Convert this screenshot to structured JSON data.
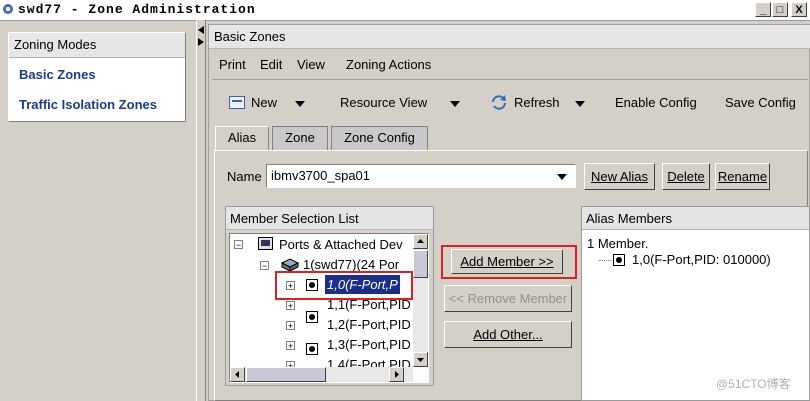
{
  "window": {
    "title": "swd77 - Zone Administration",
    "minimize": "_",
    "maximize": "□",
    "close": "X"
  },
  "left_panel": {
    "header": "Zoning Modes",
    "items": [
      {
        "label": "Basic Zones"
      },
      {
        "label": "Traffic Isolation Zones"
      }
    ]
  },
  "main": {
    "header": "Basic Zones",
    "menu": [
      "Print",
      "Edit",
      "View",
      "Zoning Actions"
    ],
    "toolbar": {
      "new": "New",
      "resource_view": "Resource View",
      "refresh": "Refresh",
      "enable_config": "Enable Config",
      "save_config": "Save Config"
    },
    "tabs": [
      "Alias",
      "Zone",
      "Zone Config"
    ],
    "name_label": "Name",
    "name_value": "ibmv3700_spa01",
    "buttons": {
      "new_alias": "New Alias",
      "delete": "Delete",
      "rename": "Rename"
    },
    "member_selection": {
      "title": "Member Selection List",
      "tree": {
        "root": "Ports & Attached Dev",
        "switch": "1(swd77)(24 Por",
        "ports": [
          "1,0(F-Port,P",
          "1,1(F-Port,PID",
          "1,2(F-Port,PID",
          "1,3(F-Port,PID",
          "1,4(F-Port,PID"
        ]
      }
    },
    "actions": {
      "add_member": "Add Member >>",
      "remove_member": "<< Remove Member",
      "add_other": "Add Other..."
    },
    "alias_members": {
      "title": "Alias Members",
      "count": "1 Member.",
      "items": [
        "1,0(F-Port,PID: 010000)"
      ]
    }
  },
  "watermark": "@51CTO博客",
  "colors": {
    "highlight": "#e02020",
    "selection": "#1a2f8c",
    "link": "#1a3c8c"
  }
}
